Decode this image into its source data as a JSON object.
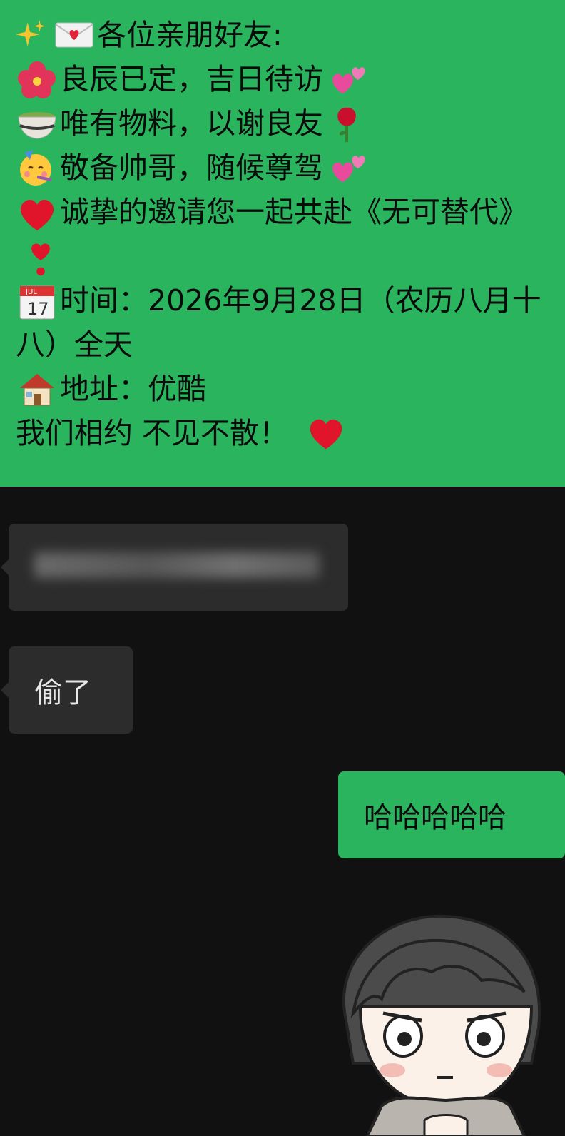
{
  "invite": {
    "lines": [
      "各位亲朋好友:",
      "良辰已定，吉日待访",
      "唯有物料，以谢良友",
      "敬备帅哥，随候尊驾",
      "诚挚的邀请您一起共赴《无可替代》",
      "时间：2026年9月28日（农历八月十八）全天",
      "地址：优酷",
      "我们相约 不见不散！"
    ],
    "icons": [
      "sparkles-icon",
      "love-letter-icon",
      "hibiscus-icon",
      "revolving-hearts-icon",
      "tea-icon",
      "rose-icon",
      "party-face-icon",
      "revolving-hearts-icon",
      "red-heart-icon",
      "exclamation-icon",
      "calendar-icon",
      "house-icon",
      "red-heart-icon"
    ],
    "calendar_month": "JUL",
    "calendar_day": "17"
  },
  "messages": [
    {
      "side": "left",
      "text": "",
      "blurred": true
    },
    {
      "side": "left",
      "text": "偷了"
    },
    {
      "side": "right",
      "text": "哈哈哈哈哈"
    }
  ],
  "colors": {
    "bubble_green": "#2ab45e",
    "background": "#111111",
    "bubble_dark": "#2c2c2c"
  },
  "sticker": {
    "icon": "cartoon-boy-sticker"
  }
}
